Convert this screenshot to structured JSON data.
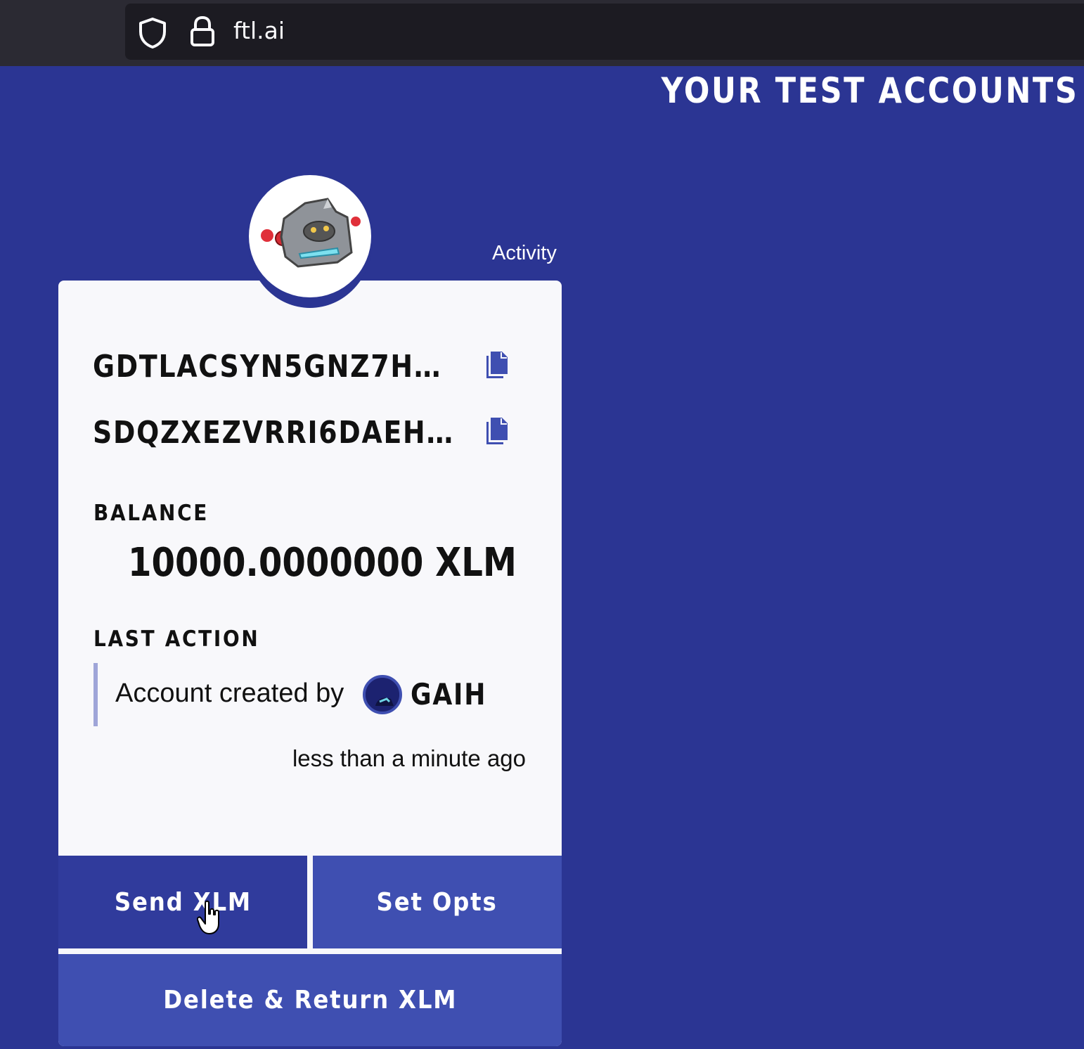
{
  "browser": {
    "url": "ftl.ai"
  },
  "page": {
    "title": "YOUR TEST ACCOUNTS",
    "activity_link": "Activity"
  },
  "account": {
    "public_key": "GDTLACSYN5GNZ7H…",
    "secret_key": "SDQZXEZVRRI6DAEH…",
    "balance_label": "BALANCE",
    "balance_value": "10000.0000000 XLM",
    "last_action_label": "LAST ACTION",
    "last_action_text": "Account created by",
    "last_action_account": "GAIH",
    "last_action_time": "less than a minute ago"
  },
  "actions": {
    "send_label": "Send XLM",
    "set_opts_label": "Set Opts",
    "delete_label": "Delete & Return XLM"
  },
  "colors": {
    "background": "#2b3593",
    "button": "#3f4fb1",
    "button_hover": "#303b9c",
    "card": "#f8f8fb"
  }
}
